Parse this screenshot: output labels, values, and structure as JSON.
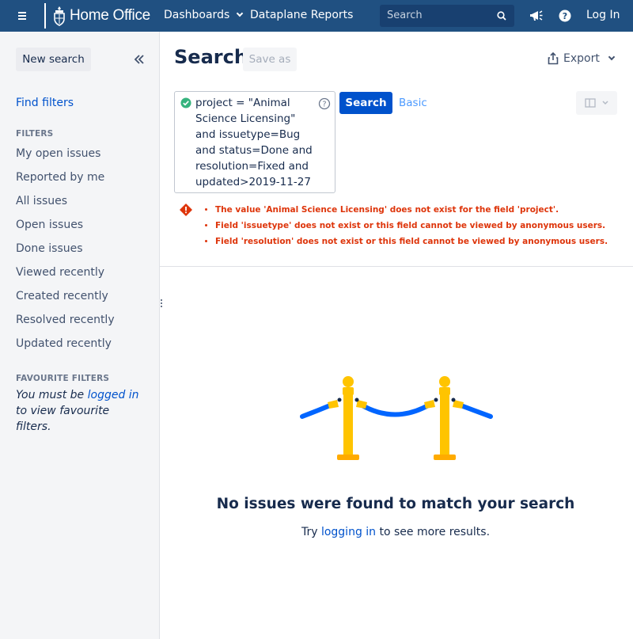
{
  "topnav": {
    "logo_text": "Home Office",
    "dashboards_label": "Dashboards",
    "reports_label": "Dataplane Reports",
    "search_placeholder": "Search",
    "login_label": "Log In"
  },
  "sidebar": {
    "new_search_label": "New search",
    "find_filters_label": "Find filters",
    "filters_heading": "FILTERS",
    "items": [
      {
        "label": "My open issues"
      },
      {
        "label": "Reported by me"
      },
      {
        "label": "All issues"
      },
      {
        "label": "Open issues"
      },
      {
        "label": "Done issues"
      },
      {
        "label": "Viewed recently"
      },
      {
        "label": "Created recently"
      },
      {
        "label": "Resolved recently"
      },
      {
        "label": "Updated recently"
      }
    ],
    "favourite_heading": "FAVOURITE FILTERS",
    "favourite_msg_before": "You must be ",
    "favourite_msg_link": "logged in",
    "favourite_msg_after": " to view favourite filters."
  },
  "main": {
    "title": "Search",
    "save_as_label": "Save as",
    "export_label": "Export",
    "jql_query": "project = \"Animal Science Licensing\" and issuetype=Bug and status=Done and resolution=Fixed and updated>2019-11-27",
    "search_button_label": "Search",
    "basic_link_label": "Basic",
    "errors": [
      "The value 'Animal Science Licensing' does not exist for the field 'project'.",
      "Field 'issuetype' does not exist or this field cannot be viewed by anonymous users.",
      "Field 'resolution' does not exist or this field cannot be viewed by anonymous users."
    ],
    "empty_title": "No issues were found to match your search",
    "empty_sub_before": "Try ",
    "empty_sub_link": "logging in",
    "empty_sub_after": " to see more results."
  },
  "colors": {
    "nav_bg": "#205081",
    "link": "#0052cc",
    "primary_button": "#0052cc",
    "error": "#de350b",
    "success": "#36b37e",
    "stanchion_gold": "#ffc400",
    "rope_blue": "#0065ff"
  },
  "icons": {
    "menu": "hamburger-icon",
    "search": "search-icon",
    "feedback": "megaphone-icon",
    "help": "help-icon",
    "collapse": "double-chevron-left-icon",
    "export": "share-icon",
    "jql_valid": "check-circle-icon",
    "jql_help": "question-circle-icon",
    "error": "error-icon",
    "layout": "list-view-icon"
  }
}
